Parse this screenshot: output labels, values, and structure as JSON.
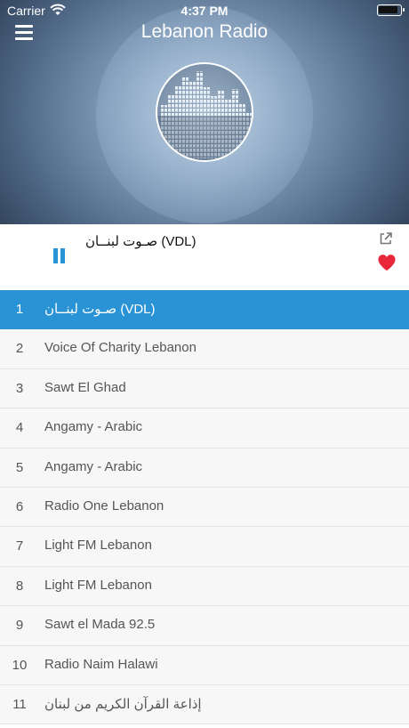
{
  "status_bar": {
    "carrier": "Carrier",
    "time": "4:37 PM"
  },
  "header": {
    "title": "Lebanon Radio"
  },
  "player": {
    "now_playing": "صـوت لبنــان (VDL)",
    "state": "playing"
  },
  "colors": {
    "accent": "#2a93d5",
    "favorite": "#e8273a"
  },
  "stations": [
    {
      "num": "1",
      "name": "صـوت لبنــان (VDL)",
      "selected": true
    },
    {
      "num": "2",
      "name": "Voice Of Charity Lebanon"
    },
    {
      "num": "3",
      "name": "Sawt El Ghad"
    },
    {
      "num": "4",
      "name": "Angamy - Arabic"
    },
    {
      "num": "5",
      "name": "Angamy - Arabic"
    },
    {
      "num": "6",
      "name": "Radio One Lebanon"
    },
    {
      "num": "7",
      "name": "Light FM Lebanon"
    },
    {
      "num": "8",
      "name": "Light FM Lebanon"
    },
    {
      "num": "9",
      "name": "Sawt el Mada 92.5"
    },
    {
      "num": "10",
      "name": "Radio Naim Halawi"
    },
    {
      "num": "11",
      "name": "إذاعة القرآن الكريم من لبنان"
    }
  ]
}
